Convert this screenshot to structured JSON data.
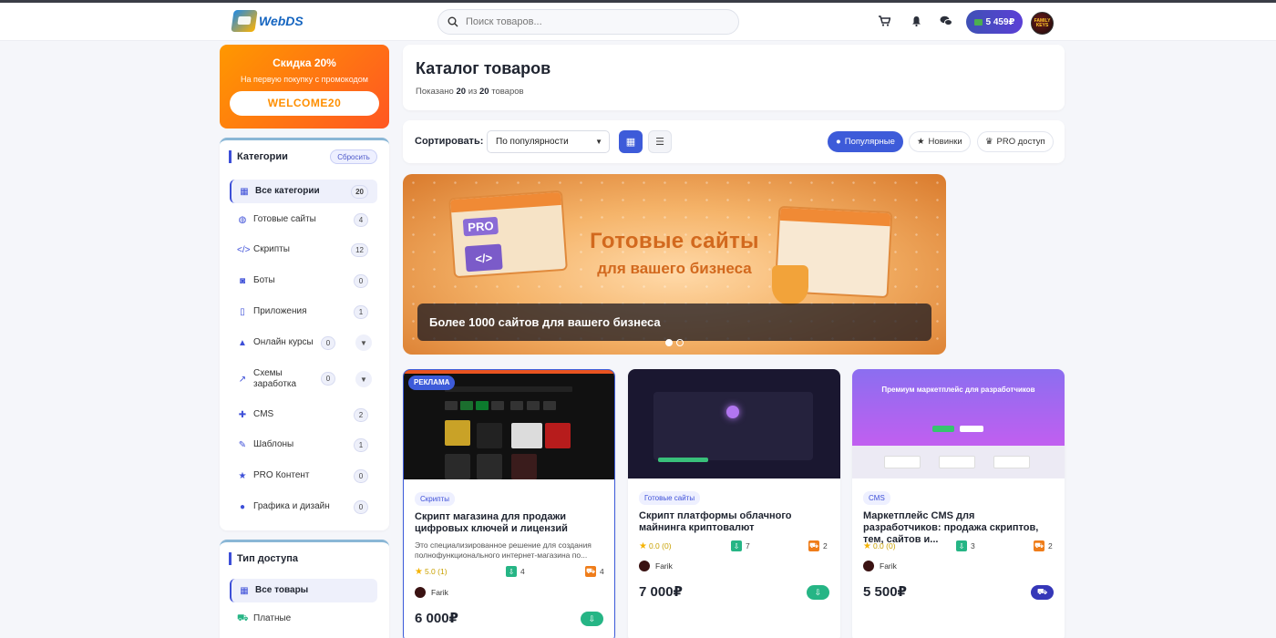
{
  "header": {
    "logo_text": "WebDS",
    "search_placeholder": "Поиск товаров...",
    "balance": "5 459₽",
    "avatar_text": "FAMILY KEYS"
  },
  "promo": {
    "title": "Скидка 20%",
    "subtitle": "На первую покупку с промокодом",
    "code": "WELCOME20"
  },
  "categories": {
    "title": "Категории",
    "reset_label": "Сбросить",
    "items": [
      {
        "label": "Все категории",
        "count": "20"
      },
      {
        "label": "Готовые сайты",
        "count": "4"
      },
      {
        "label": "Скрипты",
        "count": "12"
      },
      {
        "label": "Боты",
        "count": "0"
      },
      {
        "label": "Приложения",
        "count": "1"
      },
      {
        "label": "Онлайн курсы",
        "count": "0"
      },
      {
        "label": "Схемы заработка",
        "count": "0"
      },
      {
        "label": "CMS",
        "count": "2"
      },
      {
        "label": "Шаблоны",
        "count": "1"
      },
      {
        "label": "PRO Контент",
        "count": "0"
      },
      {
        "label": "Графика и дизайн",
        "count": "0"
      }
    ]
  },
  "access": {
    "title": "Тип доступа",
    "items": [
      {
        "label": "Все товары"
      },
      {
        "label": "Платные"
      }
    ]
  },
  "catalog": {
    "title": "Каталог товаров",
    "shown_prefix": "Показано",
    "shown_count": "20",
    "shown_of": "из",
    "shown_total": "20",
    "shown_suffix": "товаров"
  },
  "toolbar": {
    "sort_label": "Сортировать:",
    "sort_value": "По популярности",
    "filters": [
      {
        "label": "Популярные",
        "icon": "fire-icon",
        "active": true
      },
      {
        "label": "Новинки",
        "icon": "star-icon",
        "active": false
      },
      {
        "label": "PRO доступ",
        "icon": "crown-icon",
        "active": false
      }
    ]
  },
  "banner": {
    "headline": "Готовые сайты",
    "subheadline": "для вашего бизнеса",
    "badge": "PRO",
    "code_glyph": "</>",
    "caption": "Более 1000 сайтов для вашего бизнеса",
    "slides": 2,
    "active_slide": 1
  },
  "products": [
    {
      "ad_label": "РЕКЛАМА",
      "category": "Скрипты",
      "title": "Скрипт магазина для продажи цифровых ключей и лицензий",
      "description": "Это специализированное решение для создания полнофункционального интернет-магазина по...",
      "rating": "5.0 (1)",
      "downloads": "4",
      "sales": "4",
      "author": "Farik",
      "price": "6 000₽",
      "action": "download"
    },
    {
      "category": "Готовые сайты",
      "title": "Скрипт платформы облачного майнинга криптовалют",
      "rating": "0.0 (0)",
      "downloads": "7",
      "sales": "2",
      "author": "Farik",
      "price": "7 000₽",
      "action": "download"
    },
    {
      "category": "CMS",
      "title": "Маркетплейс CMS для разработчиков: продажа скриптов, тем, сайтов и...",
      "thumb_heading": "Премиум маркетплейс для разработчиков",
      "rating": "0.0 (0)",
      "downloads": "3",
      "sales": "2",
      "author": "Farik",
      "price": "5 500₽",
      "action": "cart"
    }
  ],
  "colors": {
    "accent": "#3d5bd9",
    "promo_start": "#ff9800",
    "promo_end": "#ff5722",
    "download_green": "#26b585",
    "sales_orange": "#ef7d1a",
    "rating_gold": "#f5b301"
  }
}
